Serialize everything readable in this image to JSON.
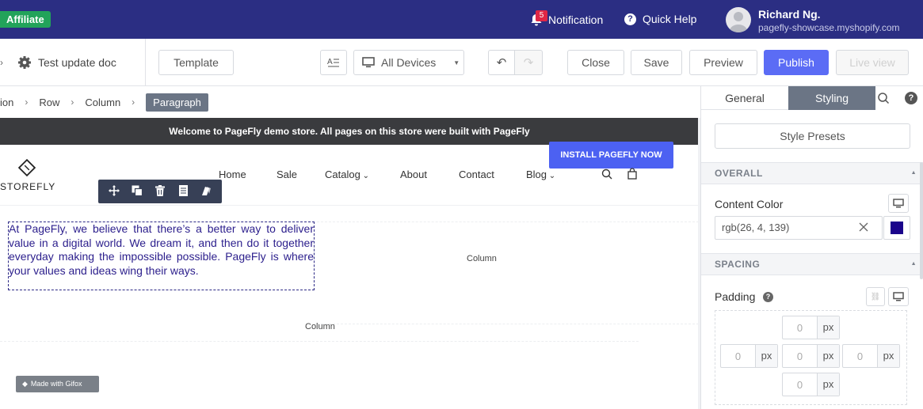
{
  "topbar": {
    "affiliate_label": "Affiliate",
    "notification_count": "5",
    "notification_label": "Notification",
    "quick_help_label": "Quick Help",
    "user_name": "Richard Ng.",
    "user_shop": "pagefly-showcase.myshopify.com",
    "bg_color": "#2b2e83"
  },
  "toolbar": {
    "doc_title": "Test update doc",
    "template_label": "Template",
    "devices_label": "All Devices",
    "close_label": "Close",
    "save_label": "Save",
    "preview_label": "Preview",
    "publish_label": "Publish",
    "live_view_label": "Live view",
    "accent_color": "#5b6cf5"
  },
  "breadcrumb": {
    "items": [
      "ion",
      "Row",
      "Column"
    ],
    "active": "Paragraph"
  },
  "canvas": {
    "promo_text": "Welcome to PageFly demo store. All pages on this store were built with PageFly",
    "install_label": "INSTALL PAGEFLY NOW",
    "store_name": "STOREFLY",
    "nav": [
      "Home",
      "Sale",
      "Catalog",
      "About",
      "Contact",
      "Blog"
    ],
    "paragraph": "At PageFly, we believe that there’s a better way to deliver value in a digital world. We dream it, and then do it together everyday making the impossible possible. PageFly is where your values and ideas wing their ways.",
    "column_label_1": "Column",
    "column_label_2": "Column",
    "gifox_label": "Made with Gifox"
  },
  "panel": {
    "tab_general": "General",
    "tab_styling": "Styling",
    "style_presets_label": "Style Presets",
    "overall_label": "OVERALL",
    "content_color_label": "Content Color",
    "content_color_value": "rgb(26, 4, 139)",
    "content_color_hex": "#1a048b",
    "spacing_label": "SPACING",
    "padding_label": "Padding",
    "padding": {
      "top": "0",
      "left": "0",
      "center": "0",
      "right": "0",
      "bottom": "0"
    },
    "unit": "px"
  }
}
